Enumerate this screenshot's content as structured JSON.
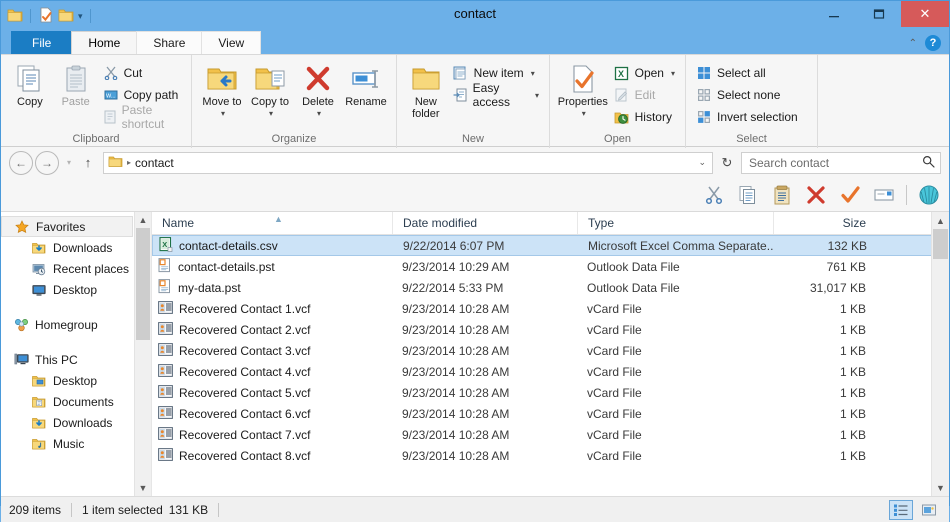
{
  "window": {
    "title": "contact",
    "minimize": "—",
    "maximize": "❐",
    "close": "✕"
  },
  "quick_access": {
    "items": [
      "folder-icon",
      "separator",
      "properties-icon",
      "new-folder-icon",
      "customize-caret",
      "separator"
    ]
  },
  "tabs": {
    "file": "File",
    "items": [
      "Home",
      "Share",
      "View"
    ],
    "active": "Home",
    "collapse_ribbon": "⌃",
    "help": "?"
  },
  "ribbon": {
    "groups": [
      {
        "label": "Clipboard",
        "big": [
          {
            "name": "Copy",
            "enabled": true
          },
          {
            "name": "Paste",
            "enabled": false
          }
        ],
        "small": [
          {
            "name": "Cut",
            "enabled": true
          },
          {
            "name": "Copy path",
            "enabled": true
          },
          {
            "name": "Paste shortcut",
            "enabled": false
          }
        ]
      },
      {
        "label": "Organize",
        "big": [
          {
            "name": "Move to",
            "caret": true
          },
          {
            "name": "Copy to",
            "caret": true
          },
          {
            "name": "Delete",
            "caret": true
          },
          {
            "name": "Rename",
            "caret": false
          }
        ]
      },
      {
        "label": "New",
        "big": [
          {
            "name": "New folder",
            "caret": false
          }
        ],
        "small": [
          {
            "name": "New item",
            "caret": true
          },
          {
            "name": "Easy access",
            "caret": true
          }
        ]
      },
      {
        "label": "Open",
        "big": [
          {
            "name": "Properties",
            "caret": true
          }
        ],
        "small": [
          {
            "name": "Open",
            "caret": true,
            "enabled": true
          },
          {
            "name": "Edit",
            "caret": false,
            "enabled": false
          },
          {
            "name": "History",
            "caret": false,
            "enabled": true
          }
        ]
      },
      {
        "label": "Select",
        "small": [
          {
            "name": "Select all"
          },
          {
            "name": "Select none"
          },
          {
            "name": "Invert selection"
          }
        ]
      }
    ]
  },
  "addressbar": {
    "back": "←",
    "forward": "→",
    "recent_caret": "▾",
    "up": "↑",
    "crumb_folder_icon": "folder-icon",
    "crumb_arrow": "▸",
    "path": "contact",
    "dropdown_caret": "⌄",
    "refresh": "↻"
  },
  "search": {
    "placeholder": "Search contact",
    "value": "",
    "icon": "search-icon"
  },
  "custom_toolbar": {
    "items": [
      "cut-icon",
      "copy-icon",
      "paste-icon",
      "delete-icon",
      "confirm-icon",
      "rename-icon",
      "separator",
      "shell-icon"
    ]
  },
  "navpane": {
    "sections": [
      {
        "header": {
          "label": "Favorites",
          "icon": "star-icon",
          "selected": true
        },
        "items": [
          {
            "label": "Downloads",
            "icon": "downloads-folder-icon"
          },
          {
            "label": "Recent places",
            "icon": "recent-places-icon"
          },
          {
            "label": "Desktop",
            "icon": "desktop-icon"
          }
        ]
      },
      {
        "header": {
          "label": "Homegroup",
          "icon": "homegroup-icon",
          "selected": false
        },
        "items": []
      },
      {
        "header": {
          "label": "This PC",
          "icon": "computer-icon",
          "selected": false
        },
        "items": [
          {
            "label": "Desktop",
            "icon": "desktop-folder-icon"
          },
          {
            "label": "Documents",
            "icon": "documents-folder-icon"
          },
          {
            "label": "Downloads",
            "icon": "downloads-folder-icon"
          },
          {
            "label": "Music",
            "icon": "music-folder-icon"
          }
        ]
      }
    ]
  },
  "filelist": {
    "columns": [
      "Name",
      "Date modified",
      "Type",
      "Size"
    ],
    "sorted_column": "Name",
    "sort_direction": "ascending",
    "rows": [
      {
        "name": "contact-details.csv",
        "date": "9/22/2014 6:07 PM",
        "type": "Microsoft Excel Comma Separate...",
        "size": "132 KB",
        "icon": "excel-csv-icon",
        "selected": true
      },
      {
        "name": "contact-details.pst",
        "date": "9/23/2014 10:29 AM",
        "type": "Outlook Data File",
        "size": "761 KB",
        "icon": "outlook-pst-icon",
        "selected": false
      },
      {
        "name": "my-data.pst",
        "date": "9/22/2014 5:33 PM",
        "type": "Outlook Data File",
        "size": "31,017 KB",
        "icon": "outlook-pst-icon",
        "selected": false
      },
      {
        "name": "Recovered Contact 1.vcf",
        "date": "9/23/2014 10:28 AM",
        "type": "vCard File",
        "size": "1 KB",
        "icon": "vcard-icon",
        "selected": false
      },
      {
        "name": "Recovered Contact 2.vcf",
        "date": "9/23/2014 10:28 AM",
        "type": "vCard File",
        "size": "1 KB",
        "icon": "vcard-icon",
        "selected": false
      },
      {
        "name": "Recovered Contact 3.vcf",
        "date": "9/23/2014 10:28 AM",
        "type": "vCard File",
        "size": "1 KB",
        "icon": "vcard-icon",
        "selected": false
      },
      {
        "name": "Recovered Contact 4.vcf",
        "date": "9/23/2014 10:28 AM",
        "type": "vCard File",
        "size": "1 KB",
        "icon": "vcard-icon",
        "selected": false
      },
      {
        "name": "Recovered Contact 5.vcf",
        "date": "9/23/2014 10:28 AM",
        "type": "vCard File",
        "size": "1 KB",
        "icon": "vcard-icon",
        "selected": false
      },
      {
        "name": "Recovered Contact 6.vcf",
        "date": "9/23/2014 10:28 AM",
        "type": "vCard File",
        "size": "1 KB",
        "icon": "vcard-icon",
        "selected": false
      },
      {
        "name": "Recovered Contact 7.vcf",
        "date": "9/23/2014 10:28 AM",
        "type": "vCard File",
        "size": "1 KB",
        "icon": "vcard-icon",
        "selected": false
      },
      {
        "name": "Recovered Contact 8.vcf",
        "date": "9/23/2014 10:28 AM",
        "type": "vCard File",
        "size": "1 KB",
        "icon": "vcard-icon",
        "selected": false
      }
    ]
  },
  "statusbar": {
    "item_count": "209 items",
    "selection": "1 item selected",
    "selection_size": "131 KB",
    "views": [
      {
        "name": "details-view",
        "active": true
      },
      {
        "name": "large-icons-view",
        "active": false
      }
    ]
  },
  "colors": {
    "titlebar": "#6cb0e8",
    "file_tab": "#1b7dc4",
    "close_button": "#d65a5a",
    "selection": "#cce3f7",
    "ribbon_bg": "#f6f6f6"
  }
}
